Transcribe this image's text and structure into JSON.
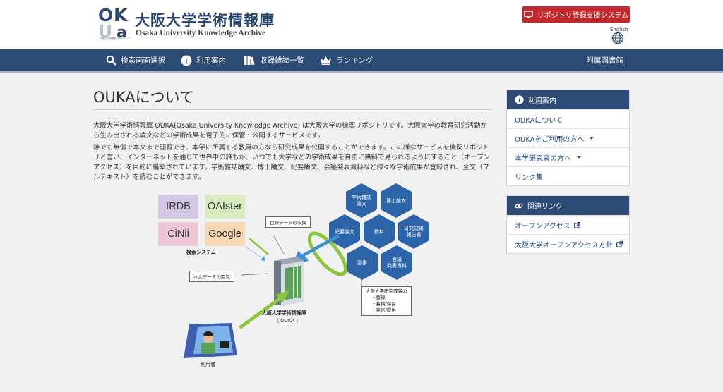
{
  "header": {
    "logo_text": "OKUa",
    "logo_sub": "大阪大学機関リポジトリ",
    "title": "大阪大学学術情報庫",
    "subtitle": "Osaka University Knowledge Archive",
    "repo_button": "リポジトリ登録支援システム",
    "language": "English"
  },
  "nav": {
    "items": [
      {
        "label": "検索画面選択",
        "icon": "search-icon"
      },
      {
        "label": "利用案内",
        "icon": "info-icon"
      },
      {
        "label": "収録雑誌一覧",
        "icon": "books-icon"
      },
      {
        "label": "ランキング",
        "icon": "crown-icon"
      }
    ],
    "right": "附属図書館"
  },
  "main": {
    "title": "OUKAについて",
    "p1": "大阪大学学術情報庫 OUKA(Osaka University Knowledge Archive) は大阪大学の機関リポジトリです。大阪大学の教育研究活動から生み出される論文などの学術成果を電子的に保管・公開するサービスです。",
    "p2": "誰でも無償で本文まで閲覧でき、本学に所属する教員の方なら研究成果を公開することができます。この様なサービスを機関リポジトリと言い、インターネットを通じて世界中の誰もが、いつでも大学などの学術成果を自由に無料で見られるようにすること（オープンアクセス）を目的に構築されています。学術雑誌論文、博士論文、紀要論文、会議発表資料など様々な学術成果が登録され、全文（フルテキスト）を読むことができます。"
  },
  "diagram": {
    "search_systems": [
      "IRDB",
      "OAIster",
      "CiNii",
      "Google"
    ],
    "search_systems_label": "検索システム",
    "metadata_callout": "目録データの収集",
    "fulltext_callout": "本文データの閲覧",
    "server_label": "大阪大学学術情報庫",
    "server_sub": "（ OUKA ）",
    "user_label": "利用者",
    "hexagons": [
      "学術雑誌\n論文",
      "博士論文",
      "紀要論文",
      "教材",
      "研究成果\n報告書",
      "図書",
      "会議\n発表資料"
    ],
    "research_callout": {
      "title": "大阪大学研究成果の",
      "items": [
        "・登録",
        "・蓄積/保存",
        "・発信/提供"
      ]
    },
    "colors": {
      "irdb": "#d4c8e6",
      "oaister": "#d8eabf",
      "cinii": "#ecc6d6",
      "google": "#f6d9b4",
      "hexagon": "#2c64a8"
    }
  },
  "sidebar": {
    "usage": {
      "title": "利用案内",
      "items": [
        {
          "label": "OUKAについて",
          "dropdown": false
        },
        {
          "label": "OUKAをご利用の方へ",
          "dropdown": true
        },
        {
          "label": "本学研究者の方へ",
          "dropdown": true
        },
        {
          "label": "リンク集",
          "dropdown": false
        }
      ]
    },
    "links": {
      "title": "関連リンク",
      "items": [
        {
          "label": "オープンアクセス"
        },
        {
          "label": "大阪大学オープンアクセス方針"
        }
      ]
    }
  }
}
